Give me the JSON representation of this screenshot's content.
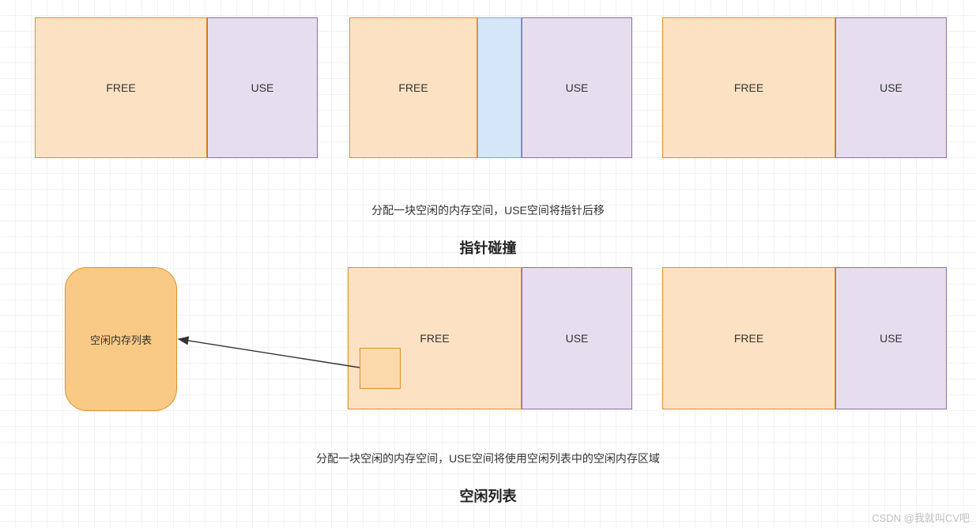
{
  "labels": {
    "free": "FREE",
    "use": "USE"
  },
  "row1": {
    "caption": "分配一块空闲的内存空间，USE空间将指针后移",
    "heading": "指针碰撞"
  },
  "row2": {
    "free_list_label": "空闲内存列表",
    "caption": "分配一块空闲的内存空间，USE空间将使用空闲列表中的空闲内存区域",
    "heading": "空闲列表"
  },
  "watermark": "CSDN @我就叫CV吧"
}
